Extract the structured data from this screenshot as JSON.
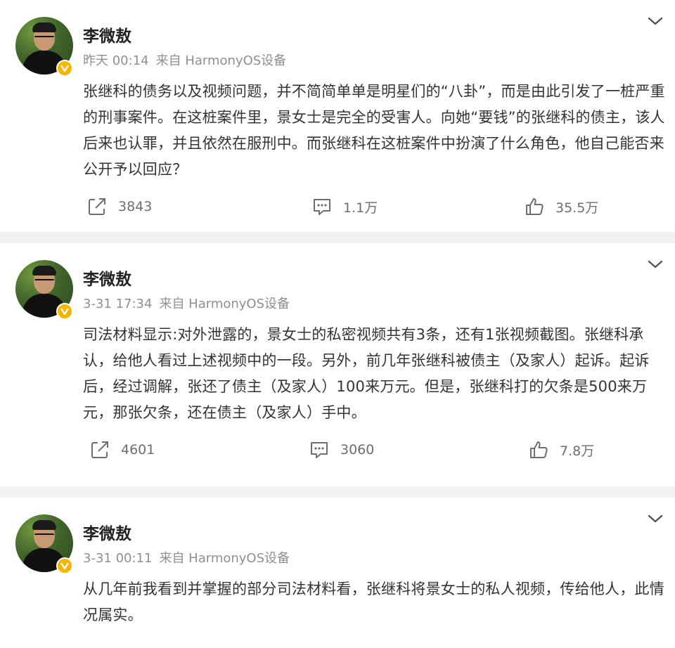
{
  "posts": [
    {
      "author": "李微敖",
      "time": "昨天 00:14",
      "source": "来自 HarmonyOS设备",
      "content": "张继科的债务以及视频问题，并不简简单单是明星们的“八卦”，而是由此引发了一桩严重的刑事案件。在这桩案件里，景女士是完全的受害人。向她“要钱”的张继科的债主，该人后来也认罪，并且依然在服刑中。而张继科在这桩案件中扮演了什么角色，他自己能否来公开予以回应？",
      "reposts": "3843",
      "comments": "1.1万",
      "likes": "35.5万"
    },
    {
      "author": "李微敖",
      "time": "3-31 17:34",
      "source": "来自 HarmonyOS设备",
      "content": "司法材料显示:对外泄露的，景女士的私密视频共有3条，还有1张视频截图。张继科承认，给他人看过上述视频中的一段。另外，前几年张继科被债主（及家人）起诉。起诉后，经过调解，张还了债主（及家人）100来万元。但是，张继科打的欠条是500来万元，那张欠条，还在债主（及家人）手中。",
      "reposts": "4601",
      "comments": "3060",
      "likes": "7.8万"
    },
    {
      "author": "李微敖",
      "time": "3-31 00:11",
      "source": "来自 HarmonyOS设备",
      "content": "从几年前我看到并掌握的部分司法材料看，张继科将景女士的私人视频，传给他人，此情况属实。"
    }
  ],
  "icons": {
    "repost": "repost-icon",
    "comment": "comment-icon",
    "like": "like-icon",
    "more": "chevron-down-icon",
    "verified": "verified-badge-icon"
  },
  "colors": {
    "verified_badge": "#f7b500",
    "meta_text": "#8f8f8f",
    "separator": "#f1f1f1"
  }
}
